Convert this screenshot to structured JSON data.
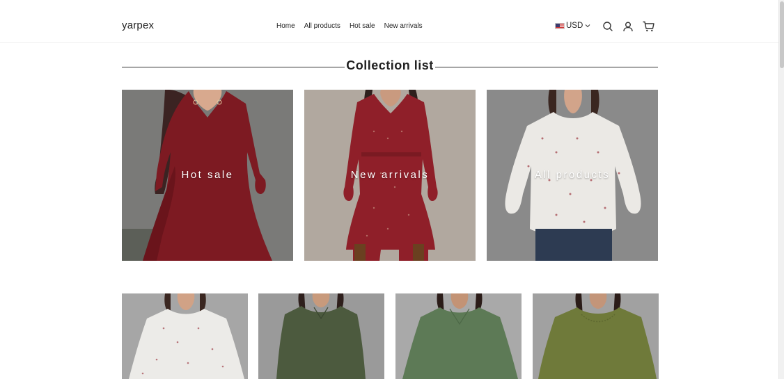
{
  "header": {
    "logo": "yarpex",
    "nav": [
      "Home",
      "All products",
      "Hot sale",
      "New arrivals"
    ],
    "currency": "USD",
    "icons": [
      "search-icon",
      "account-icon",
      "cart-icon"
    ]
  },
  "section": {
    "title": "Collection list"
  },
  "collections": [
    {
      "label": "Hot sale",
      "color": "#8c1f27"
    },
    {
      "label": "New arrivals",
      "color": "#9c2830"
    },
    {
      "label": "All products",
      "color": "#e9e7e3"
    }
  ],
  "products": [
    {
      "name": "floral-sweater",
      "color": "#ecebe8"
    },
    {
      "name": "green-knit-dress",
      "color": "#4c5a3e"
    },
    {
      "name": "green-tunic",
      "color": "#5d7a56"
    },
    {
      "name": "olive-sweater",
      "color": "#6f7a3a"
    }
  ]
}
